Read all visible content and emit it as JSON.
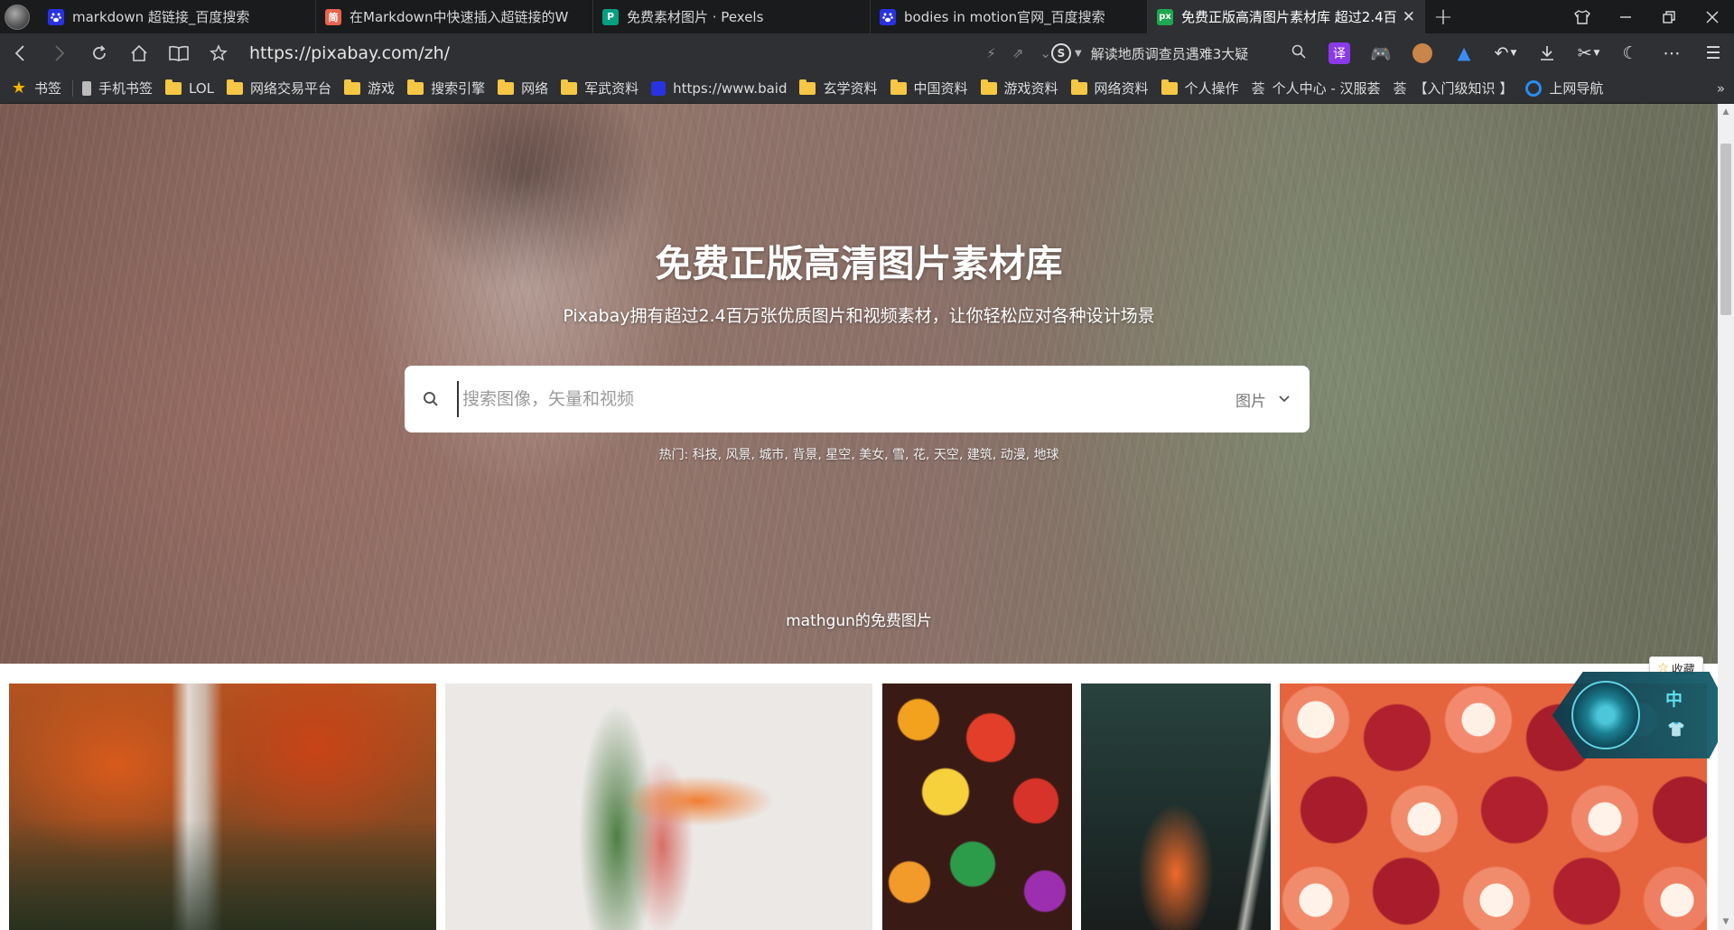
{
  "browser": {
    "tabs": [
      {
        "favicon": "baidu-paw-icon",
        "label": "markdown 超链接_百度搜索",
        "active": false
      },
      {
        "favicon": "jianshu-icon",
        "favicon_text": "简",
        "label": "在Markdown中快速插入超链接的W",
        "active": false
      },
      {
        "favicon": "pexels-icon",
        "favicon_text": "P",
        "label": "免费素材图片 · Pexels",
        "active": false
      },
      {
        "favicon": "baidu-paw-icon",
        "label": "bodies in motion官网_百度搜索",
        "active": false
      },
      {
        "favicon": "pixabay-icon",
        "favicon_text": "px",
        "label": "免费正版高清图片素材库 超过2.4百",
        "active": true
      }
    ],
    "new_tab_label": "+",
    "window_controls": [
      "skin-icon",
      "minimize-icon",
      "restore-icon",
      "close-icon"
    ],
    "address": {
      "url": "https://pixabay.com/zh/",
      "search_engine_letter": "S",
      "search_suggestion": "解读地质调查员遇难3大疑"
    },
    "toolbar_icons": [
      "translate-icon",
      "game-icon",
      "monkey-icon",
      "rocket-icon",
      "undo-icon",
      "download-icon",
      "scissors-icon",
      "night-mode-icon",
      "more-icon",
      "menu-icon"
    ],
    "translate_label": "译",
    "bookmarks": [
      {
        "icon": "star",
        "label": "书签"
      },
      {
        "icon": "phone",
        "label": "手机书签"
      },
      {
        "icon": "folder",
        "label": "LOL"
      },
      {
        "icon": "folder",
        "label": "网络交易平台"
      },
      {
        "icon": "folder",
        "label": "游戏"
      },
      {
        "icon": "folder",
        "label": "搜索引擎"
      },
      {
        "icon": "folder",
        "label": "网络"
      },
      {
        "icon": "folder",
        "label": "军武资料"
      },
      {
        "icon": "paw",
        "label": "https://www.baid"
      },
      {
        "icon": "folder",
        "label": "玄学资料"
      },
      {
        "icon": "folder",
        "label": "中国资料"
      },
      {
        "icon": "folder",
        "label": "游戏资料"
      },
      {
        "icon": "folder",
        "label": "网络资料"
      },
      {
        "icon": "folder",
        "label": "个人操作"
      },
      {
        "icon": "txt",
        "label": "个人中心 - 汉服荟"
      },
      {
        "icon": "txt",
        "label": "【入门级知识 】"
      },
      {
        "icon": "ring",
        "label": "上网导航"
      }
    ],
    "bookmarks_more": "»"
  },
  "page": {
    "hero": {
      "title": "免费正版高清图片素材库",
      "subtitle": "Pixabay拥有超过2.4百万张优质图片和视频素材，让你轻松应对各种设计场景",
      "search_placeholder": "搜索图像，矢量和视频",
      "search_type": "图片",
      "hot_label": "热门:",
      "hot_terms": "科技, 风景, 城市, 背景, 星空, 美女, 雪, 花, 天空, 建筑, 动漫, 地球",
      "credit": "mathgun的免费图片"
    },
    "gallery": [
      {
        "subject": "autumn waterfall"
      },
      {
        "subject": "bird of paradise flower"
      },
      {
        "subject": "colorful lanterns"
      },
      {
        "subject": "girl sitting in subway"
      },
      {
        "subject": "grapefruit and pomegranate"
      }
    ],
    "favorite_button": "收藏",
    "ime_widget": {
      "mode": "中"
    }
  },
  "colors": {
    "chrome_dark": "#1a1b1d",
    "chrome_toolbar": "#2f3033",
    "folder_yellow": "#f6c744",
    "scrollbar_track": "#f0f0f0"
  }
}
